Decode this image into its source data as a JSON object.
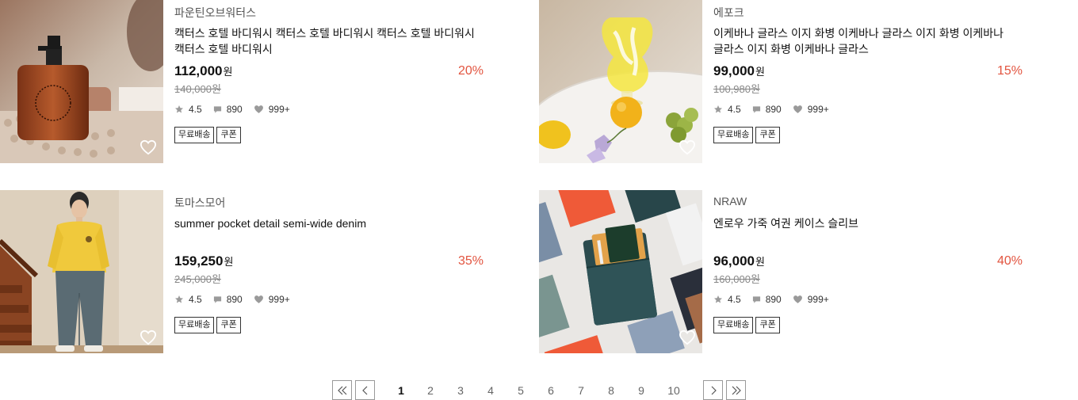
{
  "products": [
    {
      "brand": "파운틴오브워터스",
      "title": "캑터스 호텔 바디워시 캑터스 호텔 바디워시 캑터스 호텔 바디워시 캑터스 호텔 바디워시",
      "price": "112,000",
      "currency": "원",
      "original_price": "140,000원",
      "discount": "20%",
      "rating": "4.5",
      "reviews": "890",
      "likes": "999+",
      "tags": [
        "무료배송",
        "쿠폰"
      ],
      "image": "bodywash-bottle-photo"
    },
    {
      "brand": "에포크",
      "title": "이케바나 글라스 이지 화병 이케바나 글라스 이지 화병 이케바나 글라스 이지 화병 이케바나 글라스",
      "price": "99,000",
      "currency": "원",
      "original_price": "100,980원",
      "discount": "15%",
      "rating": "4.5",
      "reviews": "890",
      "likes": "999+",
      "tags": [
        "무료배송",
        "쿠폰"
      ],
      "image": "yellow-glass-vase-photo"
    },
    {
      "brand": "토마스모어",
      "title": "summer pocket detail semi-wide denim",
      "price": "159,250",
      "currency": "원",
      "original_price": "245,000원",
      "discount": "35%",
      "rating": "4.5",
      "reviews": "890",
      "likes": "999+",
      "tags": [
        "무료배송",
        "쿠폰"
      ],
      "image": "man-yellow-sweatshirt-photo"
    },
    {
      "brand": "NRAW",
      "title": "엔로우 가죽 여권 케이스 슬리브",
      "price": "96,000",
      "currency": "원",
      "original_price": "160,000원",
      "discount": "40%",
      "rating": "4.5",
      "reviews": "890",
      "likes": "999+",
      "tags": [
        "무료배송",
        "쿠폰"
      ],
      "image": "leather-passport-case-photo"
    }
  ],
  "pagination": {
    "pages": [
      "1",
      "2",
      "3",
      "4",
      "5",
      "6",
      "7",
      "8",
      "9",
      "10"
    ],
    "current": "1",
    "first_icon": "double-chevron-left-icon",
    "prev_icon": "chevron-left-icon",
    "next_icon": "chevron-right-icon",
    "last_icon": "double-chevron-right-icon"
  },
  "colors": {
    "discount": "#e2543f",
    "text": "#111111",
    "muted": "#888888"
  }
}
